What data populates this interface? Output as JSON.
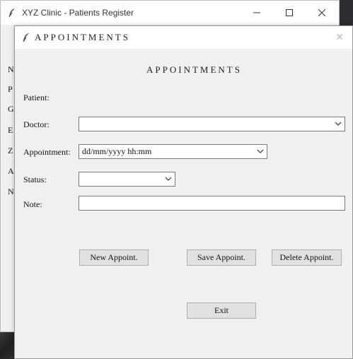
{
  "background_window": {
    "title": "XYZ Clinic - Patients Register",
    "caption_min": "—",
    "caption_max": "☐",
    "caption_close": "✕",
    "labels": [
      "N",
      "P",
      "G",
      "E",
      "Z",
      "A",
      "N"
    ]
  },
  "dialog": {
    "title": "APPOINTMENTS",
    "close_icon": "✕",
    "heading": "APPOINTMENTS",
    "fields": {
      "patient_label": "Patient:",
      "doctor_label": "Doctor:",
      "doctor_value": "",
      "appointment_label": "Appointment:",
      "appointment_value": "dd/mm/yyyy hh:mm",
      "status_label": "Status:",
      "status_value": "",
      "note_label": "Note:",
      "note_value": ""
    },
    "buttons": {
      "new": "New Appoint.",
      "save": "Save Appoint.",
      "delete": "Delete Appoint.",
      "exit": "Exit"
    }
  },
  "icons": {
    "app_icon": "feather-icon",
    "dropdown_icon": "chevron-down-icon",
    "close_icon": "close-icon"
  }
}
